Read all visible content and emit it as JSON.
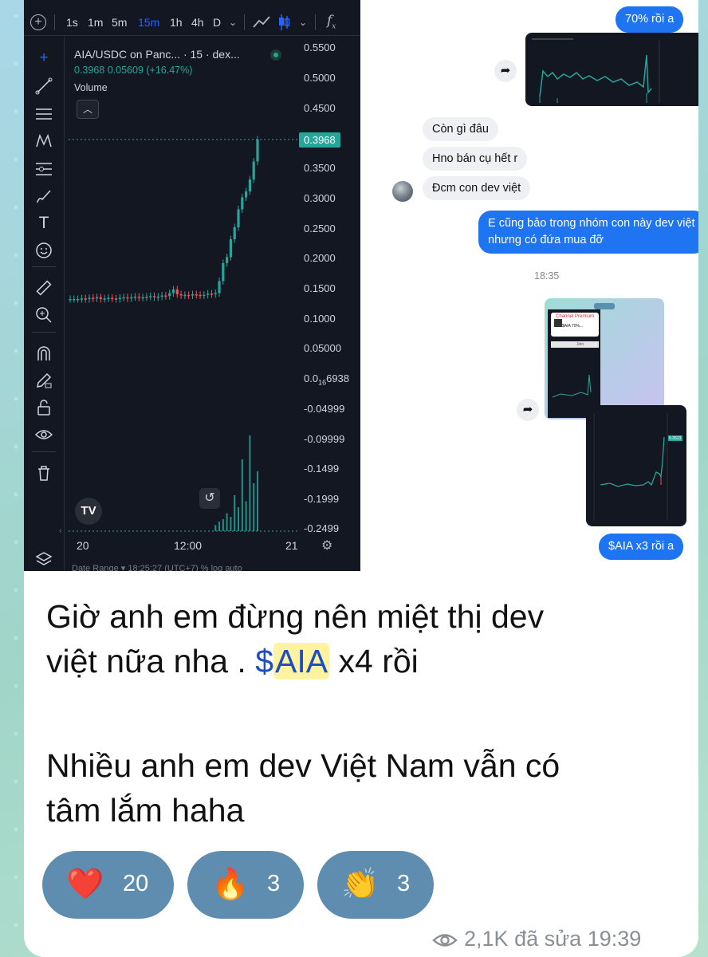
{
  "chart_toolbar": {
    "intervals": [
      "1s",
      "1m",
      "5m",
      "15m",
      "1h",
      "4h",
      "D"
    ],
    "active_interval": "15m"
  },
  "legend": {
    "symbol": "AIA/USDC on Panc...",
    "timeframe": "· 15 · dex...",
    "price": "0.3968",
    "change": "0.05609 (+16.47%)",
    "volume_label": "Volume"
  },
  "price_axis": [
    {
      "label": "0.5500"
    },
    {
      "label": "0.5000"
    },
    {
      "label": "0.4500"
    },
    {
      "label": "0.3500"
    },
    {
      "label": "0.3000"
    },
    {
      "label": "0.2500"
    },
    {
      "label": "0.2000"
    },
    {
      "label": "0.1500"
    },
    {
      "label": "0.1000"
    },
    {
      "label": "0.05000"
    },
    {
      "label_main": "0.0",
      "label_sub": "16",
      "label_tail": "6938"
    },
    {
      "label": "-0.04999"
    },
    {
      "label": "-0.09999"
    },
    {
      "label": "-0.1499"
    },
    {
      "label": "-0.1999"
    },
    {
      "label": "-0.2499"
    }
  ],
  "current_price_tag": "0.3968",
  "time_axis": {
    "x1": "20",
    "x2": "12:00",
    "x3": "21"
  },
  "chart_bottom_bar": "Date Range ▾   18:25:27 (UTC+7)   %   log   auto",
  "tv_logo": "TV",
  "chart_data": {
    "type": "candlestick",
    "title": "AIA/USDC on Panc... · 15 · dex...",
    "ylim": [
      -0.25,
      0.55
    ],
    "xlabels": [
      "20",
      "12:00",
      "21"
    ],
    "series": [
      {
        "name": "AIA/USDC close (approx.)",
        "values": [
          0.13,
          0.13,
          0.13,
          0.131,
          0.13,
          0.132,
          0.131,
          0.133,
          0.13,
          0.131,
          0.132,
          0.131,
          0.13,
          0.132,
          0.133,
          0.131,
          0.133,
          0.134,
          0.132,
          0.133,
          0.134,
          0.135,
          0.133,
          0.134,
          0.136,
          0.135,
          0.14,
          0.146,
          0.138,
          0.136,
          0.137,
          0.136,
          0.138,
          0.137,
          0.136,
          0.137,
          0.139,
          0.138,
          0.14,
          0.16,
          0.19,
          0.2,
          0.23,
          0.25,
          0.28,
          0.3,
          0.31,
          0.33,
          0.36,
          0.3968
        ]
      }
    ],
    "volume_bars_approx": [
      0,
      0,
      0,
      0,
      0,
      0,
      0,
      0,
      0,
      0,
      0,
      0,
      0,
      0,
      0,
      0,
      0,
      0,
      0,
      0,
      0,
      0,
      0,
      0,
      0,
      0,
      0,
      0,
      0,
      0,
      0,
      0,
      0,
      0,
      0,
      0,
      0,
      0,
      0.05,
      0.08,
      0.1,
      0.15,
      0.12,
      0.3,
      0.2,
      0.6,
      0.25,
      0.8,
      0.4,
      0.5
    ]
  },
  "chat": {
    "msg_top": "70% rồi a",
    "msgs_in": [
      "Còn gì đâu",
      "Hno bán cụ hết r",
      "Đcm con dev việt"
    ],
    "msg_reply": "E cũng bảo trong nhóm con này dev việt nhưng có đứa mua đỡ",
    "time": "18:35",
    "msg_last": "$AIA x3 rồi a",
    "inner_card_title": "Channel Premium",
    "inner_card_sub": "$AIA 70%...",
    "inner_button": "Join",
    "inner_price_tag": "0.3523"
  },
  "caption": {
    "line1": "Giờ anh em đừng nên miệt thị dev",
    "line2_prefix": "việt nữa nha . ",
    "hashtag_dollar": "$",
    "hashtag_word": "AIA",
    "line2_suffix": " x4 rồi",
    "line3": "Nhiều anh em dev Việt Nam vẫn có",
    "line4": "tâm lắm haha"
  },
  "reactions": [
    {
      "emoji": "❤️",
      "count": "20"
    },
    {
      "emoji": "🔥",
      "count": "3"
    },
    {
      "emoji": "👏",
      "count": "3"
    }
  ],
  "meta": {
    "views": "2,1K",
    "edited": "đã sửa",
    "time": "19:39"
  }
}
